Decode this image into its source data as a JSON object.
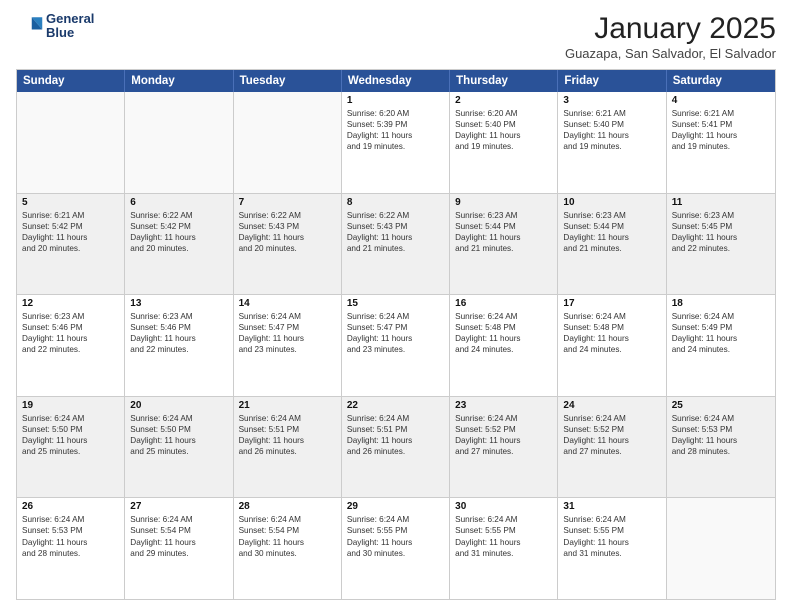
{
  "header": {
    "logo_line1": "General",
    "logo_line2": "Blue",
    "month": "January 2025",
    "location": "Guazapa, San Salvador, El Salvador"
  },
  "weekdays": [
    "Sunday",
    "Monday",
    "Tuesday",
    "Wednesday",
    "Thursday",
    "Friday",
    "Saturday"
  ],
  "rows": [
    [
      {
        "day": "",
        "lines": [],
        "empty": true
      },
      {
        "day": "",
        "lines": [],
        "empty": true
      },
      {
        "day": "",
        "lines": [],
        "empty": true
      },
      {
        "day": "1",
        "lines": [
          "Sunrise: 6:20 AM",
          "Sunset: 5:39 PM",
          "Daylight: 11 hours",
          "and 19 minutes."
        ]
      },
      {
        "day": "2",
        "lines": [
          "Sunrise: 6:20 AM",
          "Sunset: 5:40 PM",
          "Daylight: 11 hours",
          "and 19 minutes."
        ]
      },
      {
        "day": "3",
        "lines": [
          "Sunrise: 6:21 AM",
          "Sunset: 5:40 PM",
          "Daylight: 11 hours",
          "and 19 minutes."
        ]
      },
      {
        "day": "4",
        "lines": [
          "Sunrise: 6:21 AM",
          "Sunset: 5:41 PM",
          "Daylight: 11 hours",
          "and 19 minutes."
        ]
      }
    ],
    [
      {
        "day": "5",
        "lines": [
          "Sunrise: 6:21 AM",
          "Sunset: 5:42 PM",
          "Daylight: 11 hours",
          "and 20 minutes."
        ],
        "shaded": true
      },
      {
        "day": "6",
        "lines": [
          "Sunrise: 6:22 AM",
          "Sunset: 5:42 PM",
          "Daylight: 11 hours",
          "and 20 minutes."
        ],
        "shaded": true
      },
      {
        "day": "7",
        "lines": [
          "Sunrise: 6:22 AM",
          "Sunset: 5:43 PM",
          "Daylight: 11 hours",
          "and 20 minutes."
        ],
        "shaded": true
      },
      {
        "day": "8",
        "lines": [
          "Sunrise: 6:22 AM",
          "Sunset: 5:43 PM",
          "Daylight: 11 hours",
          "and 21 minutes."
        ],
        "shaded": true
      },
      {
        "day": "9",
        "lines": [
          "Sunrise: 6:23 AM",
          "Sunset: 5:44 PM",
          "Daylight: 11 hours",
          "and 21 minutes."
        ],
        "shaded": true
      },
      {
        "day": "10",
        "lines": [
          "Sunrise: 6:23 AM",
          "Sunset: 5:44 PM",
          "Daylight: 11 hours",
          "and 21 minutes."
        ],
        "shaded": true
      },
      {
        "day": "11",
        "lines": [
          "Sunrise: 6:23 AM",
          "Sunset: 5:45 PM",
          "Daylight: 11 hours",
          "and 22 minutes."
        ],
        "shaded": true
      }
    ],
    [
      {
        "day": "12",
        "lines": [
          "Sunrise: 6:23 AM",
          "Sunset: 5:46 PM",
          "Daylight: 11 hours",
          "and 22 minutes."
        ]
      },
      {
        "day": "13",
        "lines": [
          "Sunrise: 6:23 AM",
          "Sunset: 5:46 PM",
          "Daylight: 11 hours",
          "and 22 minutes."
        ]
      },
      {
        "day": "14",
        "lines": [
          "Sunrise: 6:24 AM",
          "Sunset: 5:47 PM",
          "Daylight: 11 hours",
          "and 23 minutes."
        ]
      },
      {
        "day": "15",
        "lines": [
          "Sunrise: 6:24 AM",
          "Sunset: 5:47 PM",
          "Daylight: 11 hours",
          "and 23 minutes."
        ]
      },
      {
        "day": "16",
        "lines": [
          "Sunrise: 6:24 AM",
          "Sunset: 5:48 PM",
          "Daylight: 11 hours",
          "and 24 minutes."
        ]
      },
      {
        "day": "17",
        "lines": [
          "Sunrise: 6:24 AM",
          "Sunset: 5:48 PM",
          "Daylight: 11 hours",
          "and 24 minutes."
        ]
      },
      {
        "day": "18",
        "lines": [
          "Sunrise: 6:24 AM",
          "Sunset: 5:49 PM",
          "Daylight: 11 hours",
          "and 24 minutes."
        ]
      }
    ],
    [
      {
        "day": "19",
        "lines": [
          "Sunrise: 6:24 AM",
          "Sunset: 5:50 PM",
          "Daylight: 11 hours",
          "and 25 minutes."
        ],
        "shaded": true
      },
      {
        "day": "20",
        "lines": [
          "Sunrise: 6:24 AM",
          "Sunset: 5:50 PM",
          "Daylight: 11 hours",
          "and 25 minutes."
        ],
        "shaded": true
      },
      {
        "day": "21",
        "lines": [
          "Sunrise: 6:24 AM",
          "Sunset: 5:51 PM",
          "Daylight: 11 hours",
          "and 26 minutes."
        ],
        "shaded": true
      },
      {
        "day": "22",
        "lines": [
          "Sunrise: 6:24 AM",
          "Sunset: 5:51 PM",
          "Daylight: 11 hours",
          "and 26 minutes."
        ],
        "shaded": true
      },
      {
        "day": "23",
        "lines": [
          "Sunrise: 6:24 AM",
          "Sunset: 5:52 PM",
          "Daylight: 11 hours",
          "and 27 minutes."
        ],
        "shaded": true
      },
      {
        "day": "24",
        "lines": [
          "Sunrise: 6:24 AM",
          "Sunset: 5:52 PM",
          "Daylight: 11 hours",
          "and 27 minutes."
        ],
        "shaded": true
      },
      {
        "day": "25",
        "lines": [
          "Sunrise: 6:24 AM",
          "Sunset: 5:53 PM",
          "Daylight: 11 hours",
          "and 28 minutes."
        ],
        "shaded": true
      }
    ],
    [
      {
        "day": "26",
        "lines": [
          "Sunrise: 6:24 AM",
          "Sunset: 5:53 PM",
          "Daylight: 11 hours",
          "and 28 minutes."
        ]
      },
      {
        "day": "27",
        "lines": [
          "Sunrise: 6:24 AM",
          "Sunset: 5:54 PM",
          "Daylight: 11 hours",
          "and 29 minutes."
        ]
      },
      {
        "day": "28",
        "lines": [
          "Sunrise: 6:24 AM",
          "Sunset: 5:54 PM",
          "Daylight: 11 hours",
          "and 30 minutes."
        ]
      },
      {
        "day": "29",
        "lines": [
          "Sunrise: 6:24 AM",
          "Sunset: 5:55 PM",
          "Daylight: 11 hours",
          "and 30 minutes."
        ]
      },
      {
        "day": "30",
        "lines": [
          "Sunrise: 6:24 AM",
          "Sunset: 5:55 PM",
          "Daylight: 11 hours",
          "and 31 minutes."
        ]
      },
      {
        "day": "31",
        "lines": [
          "Sunrise: 6:24 AM",
          "Sunset: 5:55 PM",
          "Daylight: 11 hours",
          "and 31 minutes."
        ]
      },
      {
        "day": "",
        "lines": [],
        "empty": true
      }
    ]
  ]
}
